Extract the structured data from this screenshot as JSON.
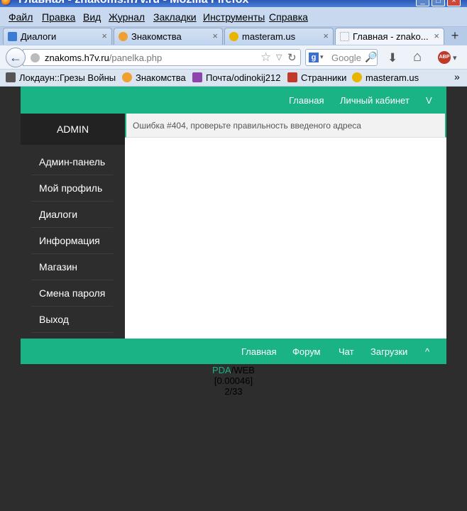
{
  "window": {
    "title": "Главная - znakoms.h7v.ru - Mozilla Firefox",
    "controls": {
      "minimize": "_",
      "maximize": "□",
      "close": "×"
    }
  },
  "menu": [
    "Файл",
    "Правка",
    "Вид",
    "Журнал",
    "Закладки",
    "Инструменты",
    "Справка"
  ],
  "tabs": [
    {
      "label": "Диалоги",
      "icon": "chat-icon",
      "color": "#3a7bd5"
    },
    {
      "label": "Знакомства",
      "icon": "cupid-icon",
      "color": "#f0a030"
    },
    {
      "label": "masteram.us",
      "icon": "smiley-icon",
      "color": "#e8b400"
    },
    {
      "label": "Главная - znako...",
      "icon": "blank-page-icon",
      "color": "#dddddd"
    }
  ],
  "tab_close": "×",
  "new_tab": "+",
  "nav": {
    "back": "←",
    "url_domain": "znakoms.h7v.ru",
    "url_path": "/panelka.php",
    "star": "☆",
    "dropdown": "▽",
    "reload": "↻",
    "search_engine": "g",
    "search_dropdown": "▾",
    "search_placeholder": "Google",
    "search_icon": "🔎",
    "download": "⬇",
    "home": "⌂",
    "adblock": "ABP",
    "adblock_dd": "▾"
  },
  "bookmarks": [
    {
      "label": "Локдаун::Грезы Войны",
      "icon": "x-icon",
      "color": "#555555"
    },
    {
      "label": "Знакомства",
      "icon": "cupid-icon",
      "color": "#f0a030"
    },
    {
      "label": "Почта/odinokij212",
      "icon": "s-icon",
      "color": "#8e44ad"
    },
    {
      "label": "Странники",
      "icon": "shield-icon",
      "color": "#c0392b"
    },
    {
      "label": "masteram.us",
      "icon": "smiley-icon",
      "color": "#e8b400"
    }
  ],
  "bookmarks_more": "»",
  "site": {
    "accent": "#1ab385",
    "top_nav": [
      "Главная",
      "Личный кабинет"
    ],
    "top_toggle": "V",
    "sidebar_header": "ADMIN",
    "sidebar_items": [
      "Админ-панель",
      "Мой профиль",
      "Диалоги",
      "Информация",
      "Магазин",
      "Смена пароля",
      "Выход"
    ],
    "error_message": "Ошибка #404, проверьте правильность введеного адреса",
    "footer_nav": [
      "Главная",
      "Форум",
      "Чат",
      "Загрузки"
    ],
    "footer_toggle": "^",
    "stats": {
      "pda": "PDA",
      "sep": "/",
      "web": "WEB",
      "gen_time": "[0.00046]",
      "online": "2/33"
    }
  }
}
